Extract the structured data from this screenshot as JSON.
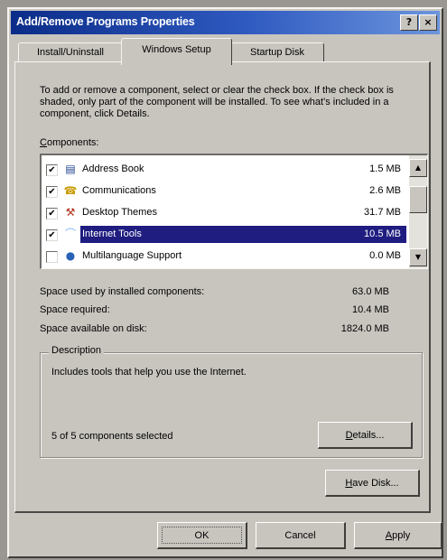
{
  "window": {
    "title": "Add/Remove Programs Properties",
    "help_glyph": "?",
    "close_glyph": "×"
  },
  "tabs": [
    {
      "label": "Install/Uninstall",
      "active": false
    },
    {
      "label": "Windows Setup",
      "active": true
    },
    {
      "label": "Startup Disk",
      "active": false
    }
  ],
  "setup": {
    "intro": "To add or remove a component, select or clear the check box. If the check box is shaded, only part of the component will be installed. To see what's included in a component, click Details.",
    "components_label_first": "C",
    "components_label_rest": "omponents:",
    "components": [
      {
        "name": "Address Book",
        "size": "1.5 MB",
        "checked": true,
        "check_glyph": "✔",
        "icon": "address-book-icon",
        "icon_glyph": "▤",
        "icon_color": "#1b3f8f",
        "selected": false
      },
      {
        "name": "Communications",
        "size": "2.6 MB",
        "checked": true,
        "check_glyph": "✔",
        "icon": "communications-icon",
        "icon_glyph": "☎",
        "icon_color": "#c99a00",
        "selected": false
      },
      {
        "name": "Desktop Themes",
        "size": "31.7 MB",
        "checked": true,
        "check_glyph": "✔",
        "icon": "desktop-themes-icon",
        "icon_glyph": "⚒",
        "icon_color": "#b3301c",
        "selected": false
      },
      {
        "name": "Internet Tools",
        "size": "10.5 MB",
        "checked": true,
        "check_glyph": "✔",
        "icon": "internet-tools-icon",
        "icon_glyph": "⌒",
        "icon_color": "#7fb3ff",
        "selected": true
      },
      {
        "name": "Multilanguage Support",
        "size": "0.0 MB",
        "checked": false,
        "check_glyph": "",
        "icon": "globe-icon",
        "icon_glyph": "●",
        "icon_color": "#2a62b8",
        "selected": false
      }
    ],
    "scroll_up_glyph": "▲",
    "scroll_down_glyph": "▼",
    "stats": [
      {
        "label": "Space used by installed components:",
        "value": "63.0 MB"
      },
      {
        "label": "Space required:",
        "value": "10.4 MB"
      },
      {
        "label": "Space available on disk:",
        "value": "1824.0 MB"
      }
    ],
    "description_label": "Description",
    "description_text": "Includes tools that help you use the Internet.",
    "selected_count": "5 of 5 components selected",
    "details_label_first": "D",
    "details_label_rest": "etails...",
    "have_disk_label_first": "H",
    "have_disk_label_rest": "ave Disk..."
  },
  "footer": {
    "ok_label": "OK",
    "cancel_label": "Cancel",
    "apply_label_first": "A",
    "apply_label_rest": "pply"
  },
  "colors": {
    "title_gradient_start": "#0b2c88",
    "title_gradient_end": "#6c95dd",
    "selection": "#1f1d80",
    "face": "#c8c5bf"
  }
}
